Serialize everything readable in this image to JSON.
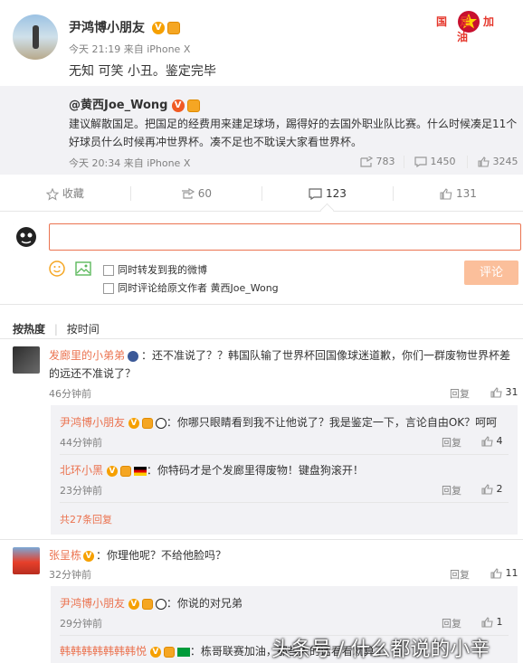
{
  "post": {
    "author": "尹鸿博小朋友",
    "time_source": "今天 21:19 来自 iPhone X",
    "text": "无知 可笑 小丑。鉴定完毕",
    "badge_logo_text": "国足加油"
  },
  "repost": {
    "author": "@黄西Joe_Wong",
    "text_line1": "建议解散国足。把国足的经费用来建足球场，踢得好的去国外职业队比赛。什么时候凑足11个",
    "text_line2": "好球员什么时候再冲世界杯。凑不足也不耽误大家看世界杯。",
    "time_source": "今天 20:34 来自 iPhone X",
    "forward_count": "783",
    "comment_count": "1450",
    "like_count": "3245"
  },
  "actions": {
    "favorite_label": "收藏",
    "forward_count": "60",
    "comment_count": "123",
    "like_count": "131"
  },
  "composer": {
    "input_value": "",
    "opt1": "同时转发到我的微博",
    "opt2": "同时评论给原文作者 黄西Joe_Wong",
    "submit": "评论"
  },
  "sort": {
    "hot": "按热度",
    "time": "按时间"
  },
  "comments": [
    {
      "user": "发廊里的小弟弟",
      "text_line1": "：还不准说了？？韩国队输了世界杯回国像球迷道歉，你们一群废物世界杯差",
      "text_line2": "的远还不准说了？",
      "time": "46分钟前",
      "reply": "回复",
      "likes": "31",
      "replies": [
        {
          "user": "尹鸿博小朋友",
          "text": "：你哪只眼睛看到我不让他说了？我是鉴定一下，言论自由OK？呵呵",
          "time": "44分钟前",
          "reply": "回复",
          "likes": "4"
        },
        {
          "user": "北环小黑",
          "text": "：你特码才是个发廊里得废物！键盘狗滚开！",
          "time": "23分钟前",
          "reply": "回复",
          "likes": "2"
        }
      ],
      "more": "共27条回复"
    },
    {
      "user": "张呈栋",
      "text_line1": "：你理他呢？不给他脸吗？",
      "time": "32分钟前",
      "reply": "回复",
      "likes": "11",
      "replies": [
        {
          "user": "尹鸿博小朋友",
          "text": "：你说的对兄弟",
          "time": "29分钟前",
          "reply": "回复",
          "likes": "1"
        },
        {
          "user": "韩韩韩韩韩韩韩悦",
          "text": "：栋哥联赛加油，那些人的话看看就算了"
        }
      ]
    }
  ],
  "watermark": "头条号 / 什么都说的小辛",
  "colors": {
    "accent": "#eb7350",
    "link": "#eb7350",
    "reply_bg": "#f2f2f5"
  }
}
